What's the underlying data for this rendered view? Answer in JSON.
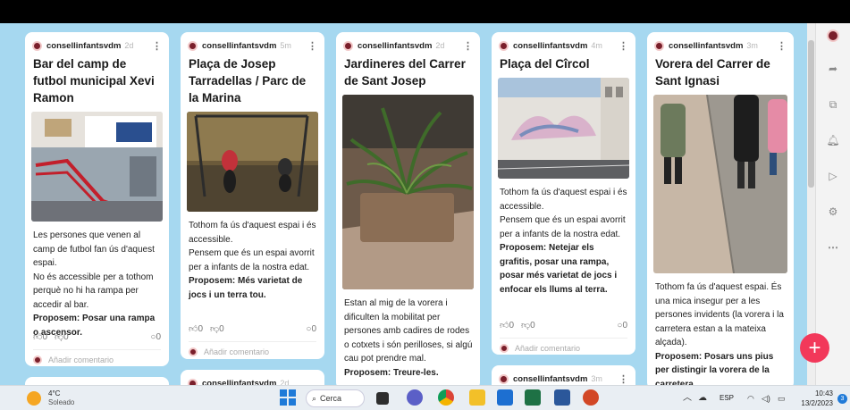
{
  "posts": [
    {
      "author": "consellinfantsvdm",
      "time": "2d",
      "title": "Bar del camp de futbol municipal Xevi Ramon",
      "body": [
        {
          "text": "Les persones que venen al camp de futbol fan ús d'aquest espai.",
          "bold": false
        },
        {
          "text": "No és accessible per a tothom perquè no hi ha rampa per accedir al bar.",
          "bold": false
        },
        {
          "text": "Proposem: Posar una rampa o ascensor.",
          "bold": true
        }
      ],
      "likes": "0",
      "dislikes": "0",
      "comments": "0",
      "comment_placeholder": "Añadir comentario"
    },
    {
      "author": "consellinfantsvdm",
      "time": "5m",
      "title": "Plaça de Josep Tarradellas / Parc de la Marina",
      "body": [
        {
          "text": "Tothom fa ús d'aquest espai i és accessible.",
          "bold": false
        },
        {
          "text": "Pensem que és un espai avorrit per a infants de la nostra edat.",
          "bold": false
        },
        {
          "text": "Proposem: Més varietat de jocs i un terra tou.",
          "bold": true
        }
      ],
      "likes": "0",
      "dislikes": "0",
      "comments": "0",
      "comment_placeholder": "Añadir comentario"
    },
    {
      "author": "consellinfantsvdm",
      "time": "2d",
      "title": "Jardineres del Carrer de Sant Josep",
      "body": [
        {
          "text": "Estan al mig de la vorera i dificulten la mobilitat per persones amb cadires de rodes o cotxets i són perilloses, si algú cau pot prendre mal.",
          "bold": false
        },
        {
          "text": "Proposem: Treure-les.",
          "bold": true
        }
      ]
    },
    {
      "author": "consellinfantsvdm",
      "time": "4m",
      "title": "Plaça del Cîrcol",
      "body": [
        {
          "text": "Tothom fa ús d'aquest espai i és accessible.",
          "bold": false
        },
        {
          "text": "Pensem que és un espai avorrit per a infants de la nostra edat.",
          "bold": false
        },
        {
          "text": "Proposem: Netejar els grafitis, posar una rampa, posar més varietat de jocs i enfocar els llums al terra.",
          "bold": true
        }
      ],
      "likes": "0",
      "dislikes": "0",
      "comments": "0",
      "comment_placeholder": "Añadir comentario"
    },
    {
      "author": "consellinfantsvdm",
      "time": "3m",
      "title": "Vorera del Carrer de Sant Ignasi",
      "body": [
        {
          "text": "Tothom fa ús d'aquest espai. És una mica insegur per a les persones invidents (la vorera i la carretera estan a la mateixa alçada).",
          "bold": false
        },
        {
          "text": "Proposem: Posars uns pius per distingir la vorera de la carretera.",
          "bold": true
        }
      ]
    }
  ],
  "partial_posts": [
    {
      "author": "consellinfantsvdm",
      "time": "2d"
    },
    {
      "author": "consellinfantsvdm",
      "time": "3m"
    }
  ],
  "fab": {
    "label": "+"
  },
  "taskbar": {
    "weather_temp": "4°C",
    "weather_desc": "Soleado",
    "search_label": "Cerca",
    "language": "ESP",
    "time": "10:43",
    "date": "13/2/2023",
    "notification_count": "3"
  },
  "colors": {
    "board": "#a6d8f0",
    "fab": "#f2385a",
    "author_avatar": "#7a1f2b"
  }
}
